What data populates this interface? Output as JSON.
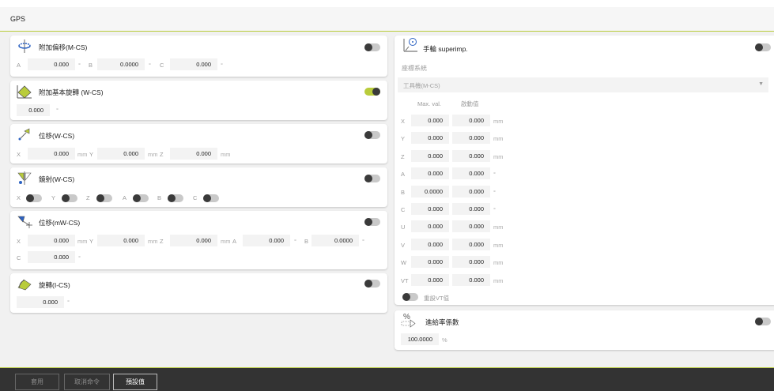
{
  "window": {
    "title": "GPS"
  },
  "left": {
    "addoffset": {
      "title": "附加偏移(M-CS)",
      "fields": [
        {
          "label": "A",
          "value": "0.000",
          "unit": "°"
        },
        {
          "label": "B",
          "value": "0.0000",
          "unit": "°"
        },
        {
          "label": "C",
          "value": "0.000",
          "unit": "°"
        }
      ]
    },
    "basicrot": {
      "title": "附加基本旋轉 (W-CS)",
      "value": "0.000",
      "unit": "°"
    },
    "shift_wcs": {
      "title": "位移(W-CS)",
      "fields": [
        {
          "label": "X",
          "value": "0.000",
          "unit": "mm"
        },
        {
          "label": "Y",
          "value": "0.000",
          "unit": "mm"
        },
        {
          "label": "Z",
          "value": "0.000",
          "unit": "mm"
        }
      ]
    },
    "mirror": {
      "title": "鏡射(W-CS)",
      "axes": [
        "X",
        "Y",
        "Z",
        "A",
        "B",
        "C"
      ]
    },
    "shift_mwcs": {
      "title": "位移(mW-CS)",
      "row1": [
        {
          "label": "X",
          "value": "0.000",
          "unit": "mm"
        },
        {
          "label": "Y",
          "value": "0.000",
          "unit": "mm"
        },
        {
          "label": "Z",
          "value": "0.000",
          "unit": "mm"
        },
        {
          "label": "A",
          "value": "0.000",
          "unit": "°"
        },
        {
          "label": "B",
          "value": "0.0000",
          "unit": "°"
        }
      ],
      "row2": [
        {
          "label": "C",
          "value": "0.000",
          "unit": "°"
        }
      ]
    },
    "rotation": {
      "title": "旋轉(I-CS)",
      "value": "0.000",
      "unit": "°"
    }
  },
  "right": {
    "handwheel": {
      "title": "手輪 superimp.",
      "coord_label": "座標系統",
      "coord_value": "工具機(M-CS)",
      "col_max": "Max. val.",
      "col_act": "啟動值",
      "rows": [
        {
          "axis": "X",
          "max": "0.000",
          "act": "0.000",
          "unit": "mm"
        },
        {
          "axis": "Y",
          "max": "0.000",
          "act": "0.000",
          "unit": "mm"
        },
        {
          "axis": "Z",
          "max": "0.000",
          "act": "0.000",
          "unit": "mm"
        },
        {
          "axis": "A",
          "max": "0.000",
          "act": "0.000",
          "unit": "°"
        },
        {
          "axis": "B",
          "max": "0.0000",
          "act": "0.000",
          "unit": "°"
        },
        {
          "axis": "C",
          "max": "0.000",
          "act": "0.000",
          "unit": "°"
        },
        {
          "axis": "U",
          "max": "0.000",
          "act": "0.000",
          "unit": "mm"
        },
        {
          "axis": "V",
          "max": "0.000",
          "act": "0.000",
          "unit": "mm"
        },
        {
          "axis": "W",
          "max": "0.000",
          "act": "0.000",
          "unit": "mm"
        },
        {
          "axis": "VT",
          "max": "0.000",
          "act": "0.000",
          "unit": "mm"
        }
      ],
      "reset_vt": "重設VT值"
    },
    "feedrate": {
      "title": "進給率係數",
      "value": "100.0000",
      "unit": "%",
      "icon_text": "%"
    }
  },
  "toolbar": {
    "apply": "套用",
    "cancel": "取消命令",
    "defaults": "預設值"
  },
  "colors": {
    "accent": "#b9cc3b",
    "toggle_knob": "#3a3a3a",
    "bottom_bar": "#333333"
  }
}
